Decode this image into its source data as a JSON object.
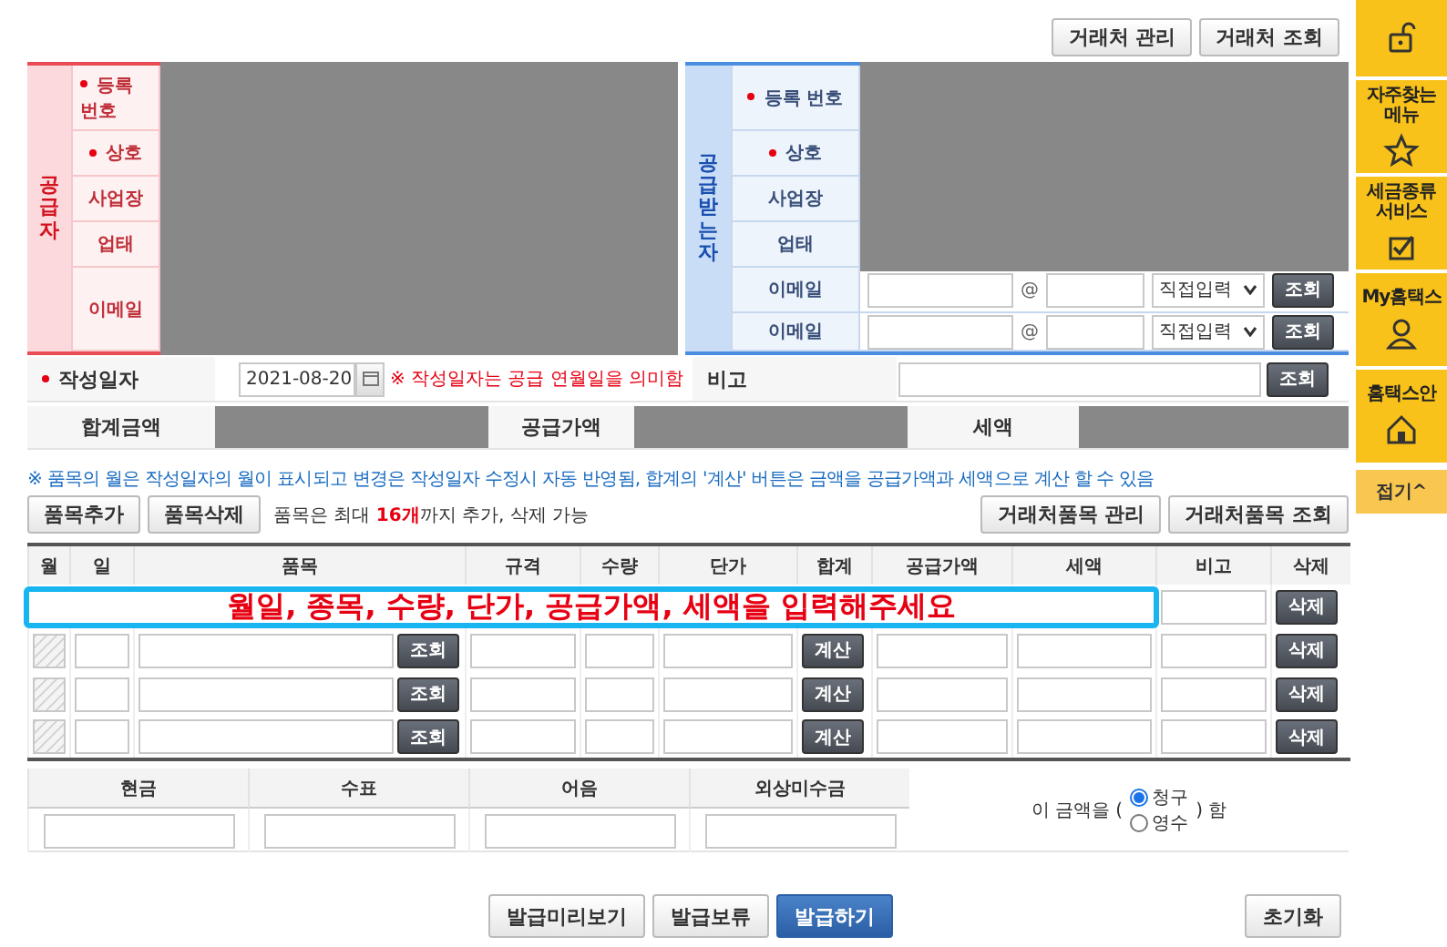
{
  "top_buttons": [
    "거래처 관리",
    "거래처 조회"
  ],
  "supplier": {
    "side_label": "공급자",
    "rows": [
      {
        "label": "등록 번호",
        "required": true,
        "kind": "redacted"
      },
      {
        "label": "상호",
        "required": true,
        "kind": "redacted"
      },
      {
        "label": "사업장",
        "required": false,
        "kind": "redacted"
      },
      {
        "label": "업태",
        "required": false,
        "kind": "redacted"
      },
      {
        "label": "이메일",
        "required": false,
        "kind": "redacted"
      }
    ]
  },
  "receiver": {
    "side_label": "공급받는자",
    "rows": [
      {
        "label": "등록 번호",
        "required": true,
        "kind": "redacted"
      },
      {
        "label": "상호",
        "required": true,
        "kind": "redacted"
      },
      {
        "label": "사업장",
        "required": false,
        "kind": "redacted"
      },
      {
        "label": "업태",
        "required": false,
        "kind": "redacted"
      },
      {
        "label": "이메일",
        "required": false,
        "kind": "email",
        "at": "@",
        "select": "직접입력",
        "button": "조회"
      },
      {
        "label": "이메일",
        "required": false,
        "kind": "email",
        "at": "@",
        "select": "직접입력",
        "button": "조회"
      }
    ]
  },
  "date_row": {
    "label": "작성일자",
    "required": true,
    "date": "2021-08-20",
    "note": "※ 작성일자는 공급 연월일을 의미함",
    "memo_label": "비고",
    "memo_button": "조회"
  },
  "totals": [
    {
      "label": "합계금액"
    },
    {
      "label": "공급가액"
    },
    {
      "label": "세액"
    }
  ],
  "notice": "※ 품목의 월은 작성일자의 월이 표시되고 변경은 작성일자 수정시 자동 반영됨, 합계의 '계산' 버튼은 금액을 공급가액과 세액으로 계산 할 수 있음",
  "item_toolbar": {
    "buttons": [
      "품목추가",
      "품목삭제"
    ],
    "hint": "품목은 최대 **16개**까지 추가, 삭제 가능",
    "right_buttons": [
      "거래처품목 관리",
      "거래처품목 조회"
    ]
  },
  "item_table": {
    "columns": [
      "월",
      "일",
      "품목",
      "규격",
      "수량",
      "단가",
      "합계",
      "공급가액",
      "세액",
      "비고",
      "삭제"
    ],
    "rows": [
      {
        "kind": "covered",
        "delete": "삭제"
      },
      {
        "month_disabled": true,
        "lookup": "조회",
        "calc": "계산",
        "delete": "삭제"
      },
      {
        "month_disabled": true,
        "lookup": "조회",
        "calc": "계산",
        "delete": "삭제"
      },
      {
        "month_disabled": true,
        "lookup": "조회",
        "calc": "계산",
        "delete": "삭제"
      }
    ]
  },
  "callout": "월일, 종목, 수량, 단가, 공급가액, 세액을 입력해주세요",
  "payment": {
    "columns": [
      "현금",
      "수표",
      "어음",
      "외상미수금"
    ],
    "prefix": "이 금액을 (",
    "options": [
      {
        "label": "청구",
        "selected": true
      },
      {
        "label": "영수",
        "selected": false
      }
    ],
    "suffix": ") 함"
  },
  "actions": [
    {
      "label": "발급미리보기",
      "primary": false
    },
    {
      "label": "발급보류",
      "primary": false
    },
    {
      "label": "발급하기",
      "primary": true
    }
  ],
  "reset": "초기화",
  "sidebar": {
    "items": [
      {
        "kind": "lock"
      },
      {
        "kind": "star",
        "label": "자주찾는 메뉴"
      },
      {
        "kind": "check",
        "label": "세금종류 서비스"
      },
      {
        "kind": "person",
        "label": "My홈택스"
      },
      {
        "kind": "house",
        "label": "홈택스안"
      }
    ],
    "collapse": "접기^"
  }
}
